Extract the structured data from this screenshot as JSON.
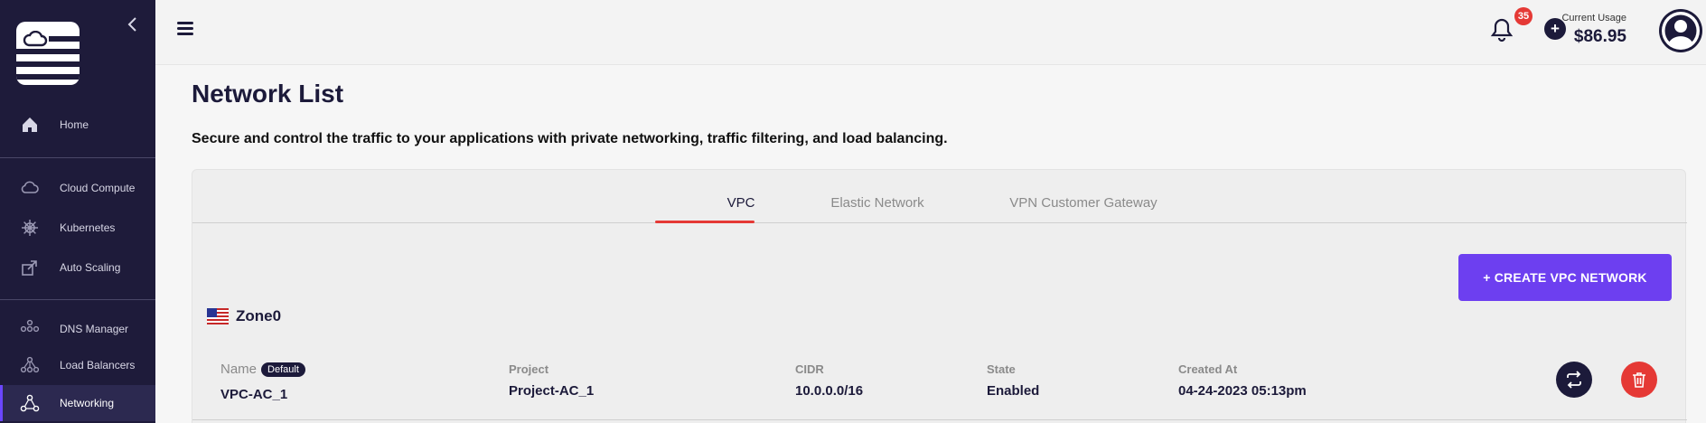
{
  "sidebar": {
    "items": [
      {
        "label": "Home",
        "icon": "home-icon"
      },
      {
        "label": "Cloud Compute",
        "icon": "cloud-icon"
      },
      {
        "label": "Kubernetes",
        "icon": "helm-icon"
      },
      {
        "label": "Auto Scaling",
        "icon": "scale-icon"
      },
      {
        "label": "DNS Manager",
        "icon": "dns-icon"
      },
      {
        "label": "Load Balancers",
        "icon": "load-balancer-icon"
      },
      {
        "label": "Networking",
        "icon": "network-icon"
      }
    ],
    "active_item": "Networking"
  },
  "header": {
    "notification_count": "35",
    "usage_label": "Current Usage",
    "usage_value": "$86.95"
  },
  "main": {
    "title": "Network List",
    "description": "Secure and control the traffic to your applications with private networking, traffic filtering, and load balancing.",
    "tabs": [
      {
        "label": "VPC",
        "active": true
      },
      {
        "label": "Elastic Network",
        "active": false
      },
      {
        "label": "VPN Customer Gateway",
        "active": false
      }
    ],
    "create_button": "+ CREATE VPC NETWORK",
    "zone": {
      "name": "Zone0",
      "flag": "us-flag-icon"
    },
    "columns": {
      "name": "Name",
      "project": "Project",
      "cidr": "CIDR",
      "state": "State",
      "created_at": "Created At"
    },
    "rows": [
      {
        "name": "VPC-AC_1",
        "default_badge": "Default",
        "project": "Project-AC_1",
        "cidr": "10.0.0.0/16",
        "state": "Enabled",
        "created_at": "04-24-2023 05:13pm"
      }
    ]
  },
  "colors": {
    "sidebar_bg": "#1e1b3a",
    "accent": "#6d3ff0",
    "danger": "#e53935",
    "text_dark": "#1c1a3a"
  }
}
